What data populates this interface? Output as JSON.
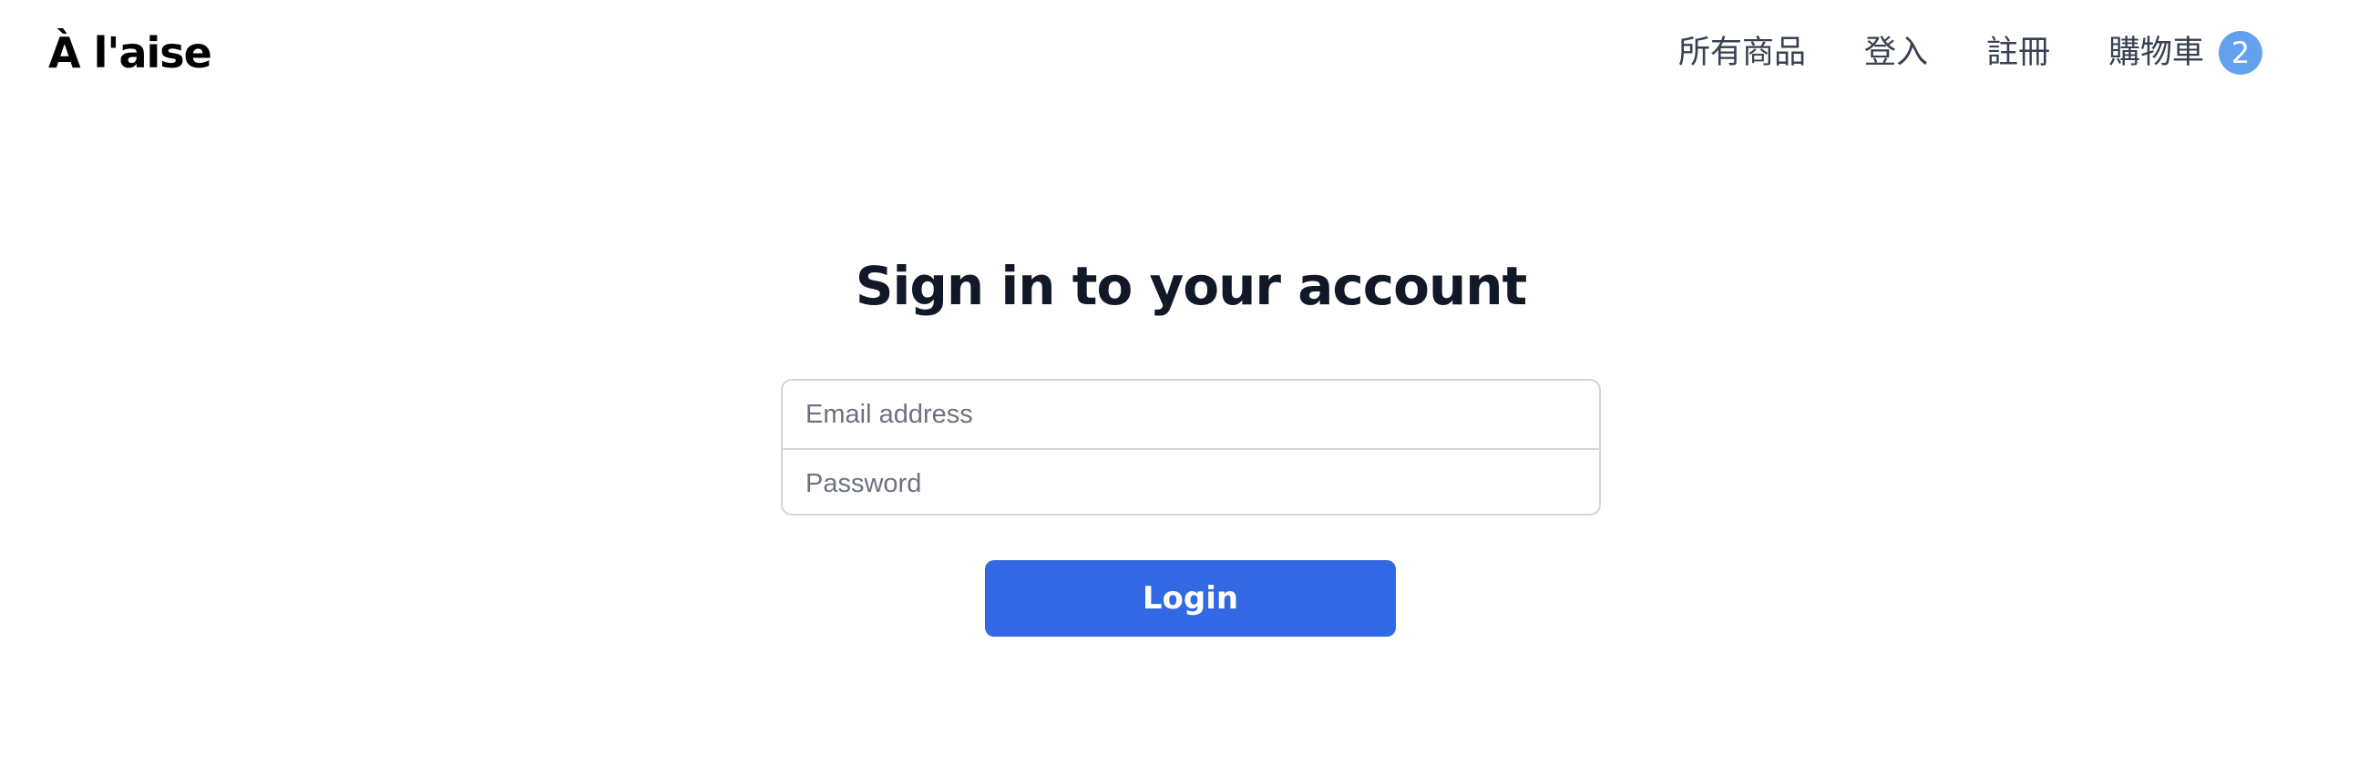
{
  "header": {
    "brand": "À l'aise",
    "nav": {
      "products": "所有商品",
      "login": "登入",
      "register": "註冊",
      "cart": "購物車",
      "cart_count": "2"
    }
  },
  "main": {
    "title": "Sign in to your account",
    "email": {
      "placeholder": "Email address",
      "value": ""
    },
    "password": {
      "placeholder": "Password",
      "value": ""
    },
    "login_label": "Login"
  },
  "colors": {
    "primary": "#3268e3",
    "badge": "#63a1ee",
    "heading": "#111827",
    "nav_text": "#374151",
    "border": "#d1d5db",
    "placeholder": "#6b7280"
  }
}
